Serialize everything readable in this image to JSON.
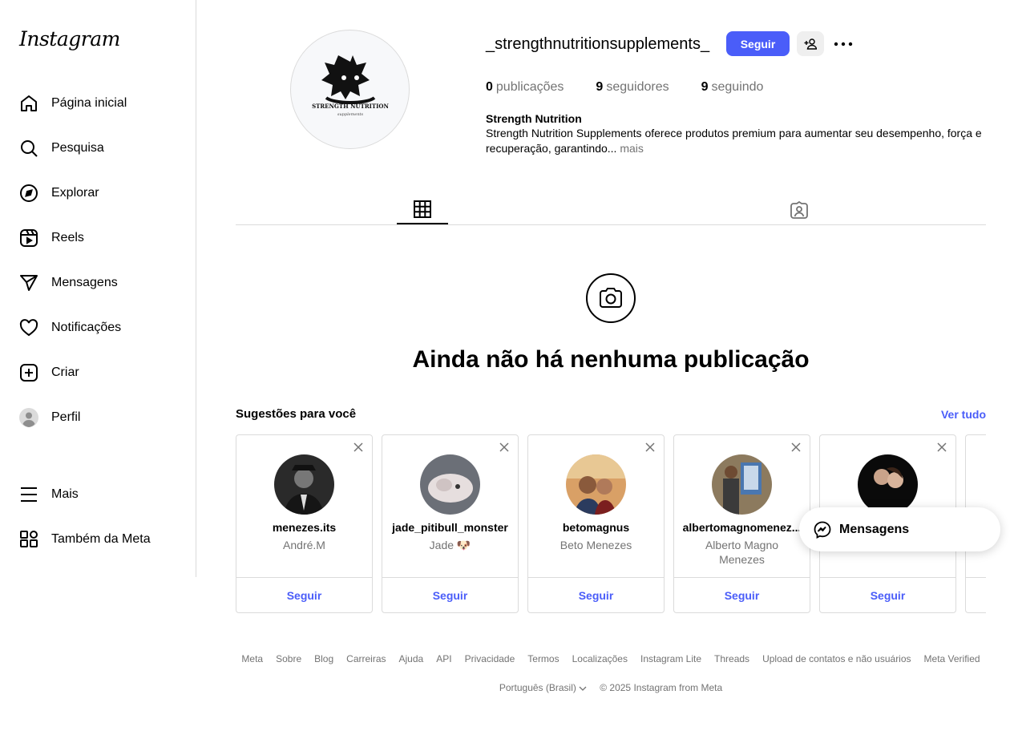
{
  "app": {
    "logo_text": "Instagram"
  },
  "sidebar": {
    "items": [
      {
        "label": "Página inicial",
        "icon": "home-icon"
      },
      {
        "label": "Pesquisa",
        "icon": "search-icon"
      },
      {
        "label": "Explorar",
        "icon": "compass-icon"
      },
      {
        "label": "Reels",
        "icon": "reels-icon"
      },
      {
        "label": "Mensagens",
        "icon": "send-icon"
      },
      {
        "label": "Notificações",
        "icon": "heart-icon"
      },
      {
        "label": "Criar",
        "icon": "plus-square-icon"
      },
      {
        "label": "Perfil",
        "icon": "profile-avatar-icon"
      }
    ],
    "bottom_items": [
      {
        "label": "Mais",
        "icon": "menu-icon"
      },
      {
        "label": "Também da Meta",
        "icon": "meta-apps-icon"
      }
    ]
  },
  "profile": {
    "username": "_strengthnutritionsupplements_",
    "follow_label": "Seguir",
    "stats": [
      {
        "count": "0",
        "label": "publicações"
      },
      {
        "count": "9",
        "label": "seguidores"
      },
      {
        "count": "9",
        "label": "seguindo"
      }
    ],
    "name": "Strength Nutrition",
    "bio": "Strength Nutrition Supplements oferece produtos premium para aumentar seu desempenho, força e recuperação, garantindo...",
    "bio_more": "mais",
    "logo_text": "STRENGTH NUTRITION",
    "logo_subtext": "supplements"
  },
  "tabs": [
    {
      "name": "posts",
      "icon": "grid-icon",
      "active": true
    },
    {
      "name": "tagged",
      "icon": "tagged-icon",
      "active": false
    }
  ],
  "empty_state": {
    "title": "Ainda não há nenhuma publicação"
  },
  "suggestions": {
    "title": "Sugestões para você",
    "see_all": "Ver tudo",
    "follow_label": "Seguir",
    "cards": [
      {
        "username": "menezes.its",
        "fullname": "André.M"
      },
      {
        "username": "jade_pitibull_monster",
        "fullname": "Jade 🐶"
      },
      {
        "username": "betomagnus",
        "fullname": "Beto Menezes"
      },
      {
        "username": "albertomagnomenez...",
        "fullname": "Alberto Magno Menezes"
      },
      {
        "username": "",
        "fullname": ""
      }
    ]
  },
  "messages_pill": {
    "label": "Mensagens"
  },
  "footer": {
    "links": [
      "Meta",
      "Sobre",
      "Blog",
      "Carreiras",
      "Ajuda",
      "API",
      "Privacidade",
      "Termos",
      "Localizações",
      "Instagram Lite",
      "Threads",
      "Upload de contatos e não usuários",
      "Meta Verified"
    ],
    "language": "Português (Brasil)",
    "copyright": "© 2025 Instagram from Meta"
  },
  "colors": {
    "accent": "#4a5df9",
    "muted": "#737373",
    "border": "#dbdbdb"
  }
}
